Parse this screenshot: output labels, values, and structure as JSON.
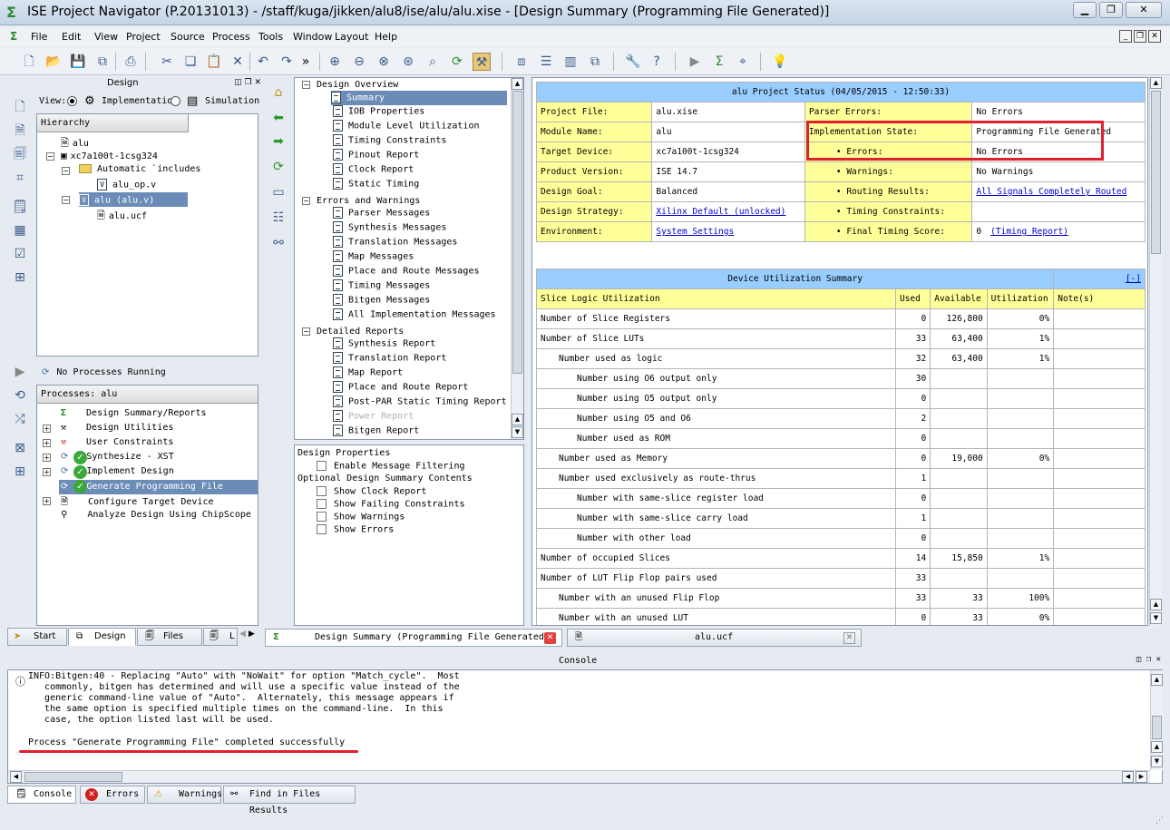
{
  "window": {
    "title": "ISE Project Navigator (P.20131013) - /staff/kuga/jikken/alu8/ise/alu/alu.xise - [Design Summary (Programming File Generated)]"
  },
  "menu": [
    "File",
    "Edit",
    "View",
    "Project",
    "Source",
    "Process",
    "Tools",
    "Window",
    "Layout",
    "Help"
  ],
  "design_panel": {
    "title": "Design",
    "view_label": "View:",
    "view_impl": "Implementation",
    "view_sim": "Simulation",
    "hierarchy_label": "Hierarchy",
    "tree": [
      "alu",
      "xc7a100t-1csg324",
      "Automatic `includes",
      "alu_op.v",
      "alu (alu.v)",
      "alu.ucf"
    ]
  },
  "processes": {
    "status": "No Processes Running",
    "header": "Processes: alu",
    "items": [
      "Design Summary/Reports",
      "Design Utilities",
      "User Constraints",
      "Synthesize - XST",
      "Implement Design",
      "Generate Programming File",
      "Configure Target Device",
      "Analyze Design Using ChipScope"
    ]
  },
  "left_tabs": [
    "Start",
    "Design",
    "Files",
    "L"
  ],
  "summary_nav": {
    "design_overview": "Design Overview",
    "overview_items": [
      "Summary",
      "IOB Properties",
      "Module Level Utilization",
      "Timing Constraints",
      "Pinout Report",
      "Clock Report",
      "Static Timing"
    ],
    "errors_warnings": "Errors and Warnings",
    "ew_items": [
      "Parser Messages",
      "Synthesis Messages",
      "Translation Messages",
      "Map Messages",
      "Place and Route Messages",
      "Timing Messages",
      "Bitgen Messages",
      "All Implementation Messages"
    ],
    "detailed_reports": "Detailed Reports",
    "detailed_items": [
      "Synthesis Report",
      "Translation Report",
      "Map Report",
      "Place and Route Report",
      "Post-PAR Static Timing Report",
      "Power Report",
      "Bitgen Report"
    ]
  },
  "design_props": {
    "title": "Design Properties",
    "enable_filtering": "Enable Message Filtering",
    "optional": "Optional Design Summary Contents",
    "options": [
      "Show Clock Report",
      "Show Failing Constraints",
      "Show Warnings",
      "Show Errors"
    ]
  },
  "status_table": {
    "title": "alu Project Status (04/05/2015 - 12:50:33)",
    "rows": [
      [
        "Project File:",
        "alu.xise",
        "Parser Errors:",
        "No Errors"
      ],
      [
        "Module Name:",
        "alu",
        "Implementation State:",
        "Programming File Generated"
      ],
      [
        "Target Device:",
        "xc7a100t-1csg324",
        "• Errors:",
        "No Errors"
      ],
      [
        "Product Version:",
        "ISE 14.7",
        "• Warnings:",
        "No Warnings"
      ],
      [
        "Design Goal:",
        "Balanced",
        "• Routing Results:",
        "All Signals Completely Routed"
      ],
      [
        "Design Strategy:",
        "Xilinx Default (unlocked)",
        "• Timing Constraints:",
        ""
      ],
      [
        "Environment:",
        "System Settings",
        "• Final Timing Score:",
        "0"
      ]
    ],
    "timing_report_link": "(Timing Report)"
  },
  "util_table": {
    "title": "Device Utilization Summary",
    "collapse": "[-]",
    "headers": [
      "Slice Logic Utilization",
      "Used",
      "Available",
      "Utilization",
      "Note(s)"
    ],
    "rows": [
      [
        "Number of Slice Registers",
        "0",
        "126,800",
        "0%",
        ""
      ],
      [
        "Number of Slice LUTs",
        "33",
        "63,400",
        "1%",
        ""
      ],
      [
        "Number used as logic",
        "32",
        "63,400",
        "1%",
        ""
      ],
      [
        "Number using O6 output only",
        "30",
        "",
        "",
        ""
      ],
      [
        "Number using O5 output only",
        "0",
        "",
        "",
        ""
      ],
      [
        "Number using O5 and O6",
        "2",
        "",
        "",
        ""
      ],
      [
        "Number used as ROM",
        "0",
        "",
        "",
        ""
      ],
      [
        "Number used as Memory",
        "0",
        "19,000",
        "0%",
        ""
      ],
      [
        "Number used exclusively as route-thrus",
        "1",
        "",
        "",
        ""
      ],
      [
        "Number with same-slice register load",
        "0",
        "",
        "",
        ""
      ],
      [
        "Number with same-slice carry load",
        "1",
        "",
        "",
        ""
      ],
      [
        "Number with other load",
        "0",
        "",
        "",
        ""
      ],
      [
        "Number of occupied Slices",
        "14",
        "15,850",
        "1%",
        ""
      ],
      [
        "Number of LUT Flip Flop pairs used",
        "33",
        "",
        "",
        ""
      ],
      [
        "Number with an unused Flip Flop",
        "33",
        "33",
        "100%",
        ""
      ],
      [
        "Number with an unused LUT",
        "0",
        "33",
        "0%",
        ""
      ]
    ]
  },
  "doc_tabs": [
    "Design Summary (Programming File Generated)",
    "alu.ucf"
  ],
  "console": {
    "title": "Console",
    "lines": [
      "INFO:Bitgen:40 - Replacing \"Auto\" with \"NoWait\" for option \"Match_cycle\".  Most",
      "   commonly, bitgen has determined and will use a specific value instead of the",
      "   generic command-line value of \"Auto\".  Alternately, this message appears if",
      "   the same option is specified multiple times on the command-line.  In this",
      "   case, the option listed last will be used."
    ],
    "success": "Process \"Generate Programming File\" completed successfully",
    "tabs": [
      "Console",
      "Errors",
      "Warnings",
      "Find in Files Results"
    ]
  },
  "colors": {
    "highlight_box": "#e0202e",
    "selection": "#6c8cb8",
    "yellow_cell": "#ffff99",
    "header_blue": "#99ccff"
  }
}
